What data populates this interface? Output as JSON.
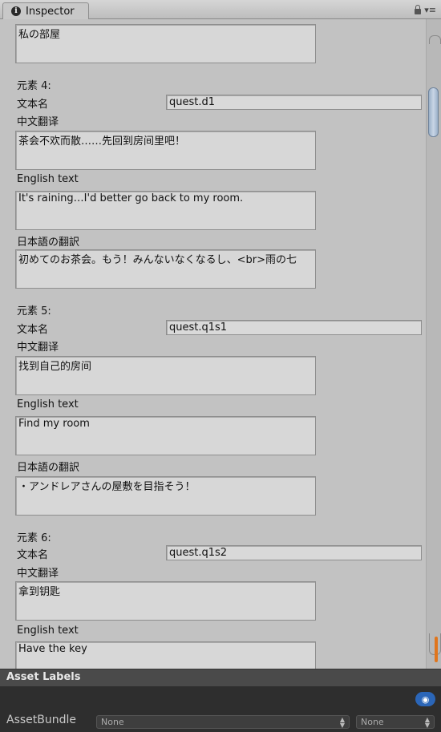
{
  "tab": {
    "title": "Inspector"
  },
  "entries": [
    {
      "kind": "tail",
      "jp": "私の部屋"
    },
    {
      "kind": "full",
      "header": "元素 4:",
      "name_label": "文本名",
      "name": "quest.d1",
      "zh_label": "中文翻译",
      "zh": "茶会不欢而散……先回到房间里吧！",
      "en_label": "English text",
      "en": "It's raining…I'd better go back to my room.",
      "jp_label": "日本語の翻訳",
      "jp": "初めてのお茶会。もう！みんないなくなるし、<br>雨の七"
    },
    {
      "kind": "full",
      "header": "元素 5:",
      "name_label": "文本名",
      "name": "quest.q1s1",
      "zh_label": "中文翻译",
      "zh": "找到自己的房间",
      "en_label": "English text",
      "en": "Find my room",
      "jp_label": "日本語の翻訳",
      "jp": "・アンドレアさんの屋敷を目指そう！"
    },
    {
      "kind": "partial",
      "header": "元素 6:",
      "name_label": "文本名",
      "name": "quest.q1s2",
      "zh_label": "中文翻译",
      "zh": "拿到钥匙",
      "en_label": "English text",
      "en": "Have the key"
    }
  ],
  "asset_labels": {
    "title": "Asset Labels",
    "bundle_label": "AssetBundle",
    "bundle_value": "None",
    "variant_value": "None"
  },
  "colors": {
    "accent": "#2b66b8",
    "scroll_marker": "#e0751c"
  },
  "icons": {
    "tab": "info-icon",
    "lock": "lock-icon",
    "menu": "menu-icon",
    "tag": "tag-icon"
  }
}
